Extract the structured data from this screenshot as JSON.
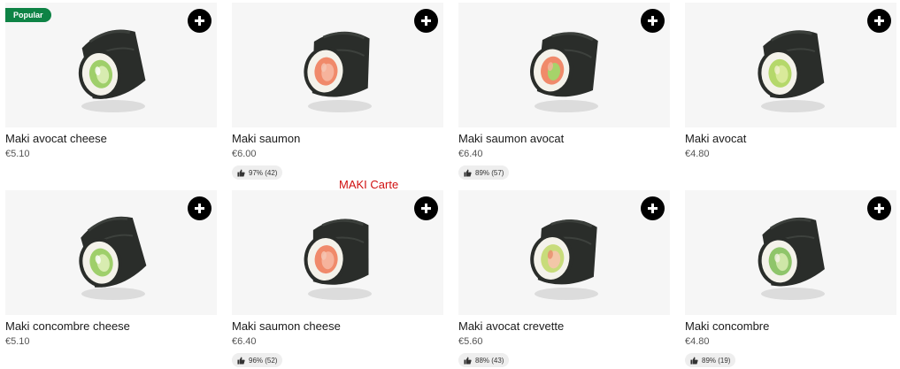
{
  "section_title": "MAKI Carte",
  "products": [
    {
      "name": "Maki avocat cheese",
      "price": "€5.10",
      "badge": "Popular",
      "rating": "",
      "filling": "cucumber-cheese",
      "icon": "plus-icon"
    },
    {
      "name": "Maki saumon",
      "price": "€6.00",
      "badge": "",
      "rating": "97% (42)",
      "filling": "salmon",
      "icon": "plus-icon"
    },
    {
      "name": "Maki saumon avocat",
      "price": "€6.40",
      "badge": "",
      "rating": "89% (57)",
      "filling": "salmon-avocado",
      "icon": "plus-icon"
    },
    {
      "name": "Maki avocat",
      "price": "€4.80",
      "badge": "",
      "rating": "",
      "filling": "avocado",
      "icon": "plus-icon"
    },
    {
      "name": "Maki concombre cheese",
      "price": "€5.10",
      "badge": "",
      "rating": "",
      "filling": "cucumber-cheese",
      "icon": "plus-icon"
    },
    {
      "name": "Maki saumon cheese",
      "price": "€6.40",
      "badge": "",
      "rating": "96% (52)",
      "filling": "salmon",
      "icon": "plus-icon"
    },
    {
      "name": "Maki avocat crevette",
      "price": "€5.60",
      "badge": "",
      "rating": "88% (43)",
      "filling": "avocado-shrimp",
      "icon": "plus-icon"
    },
    {
      "name": "Maki concombre",
      "price": "€4.80",
      "badge": "",
      "rating": "89% (19)",
      "filling": "cucumber",
      "icon": "plus-icon"
    }
  ],
  "colors": {
    "badge_bg": "#0e8345",
    "button_bg": "#000000",
    "rating_bg": "#eeeeee",
    "title_red": "#d01010",
    "nori": "#2a2d2a",
    "rice": "#f4f2ea"
  }
}
